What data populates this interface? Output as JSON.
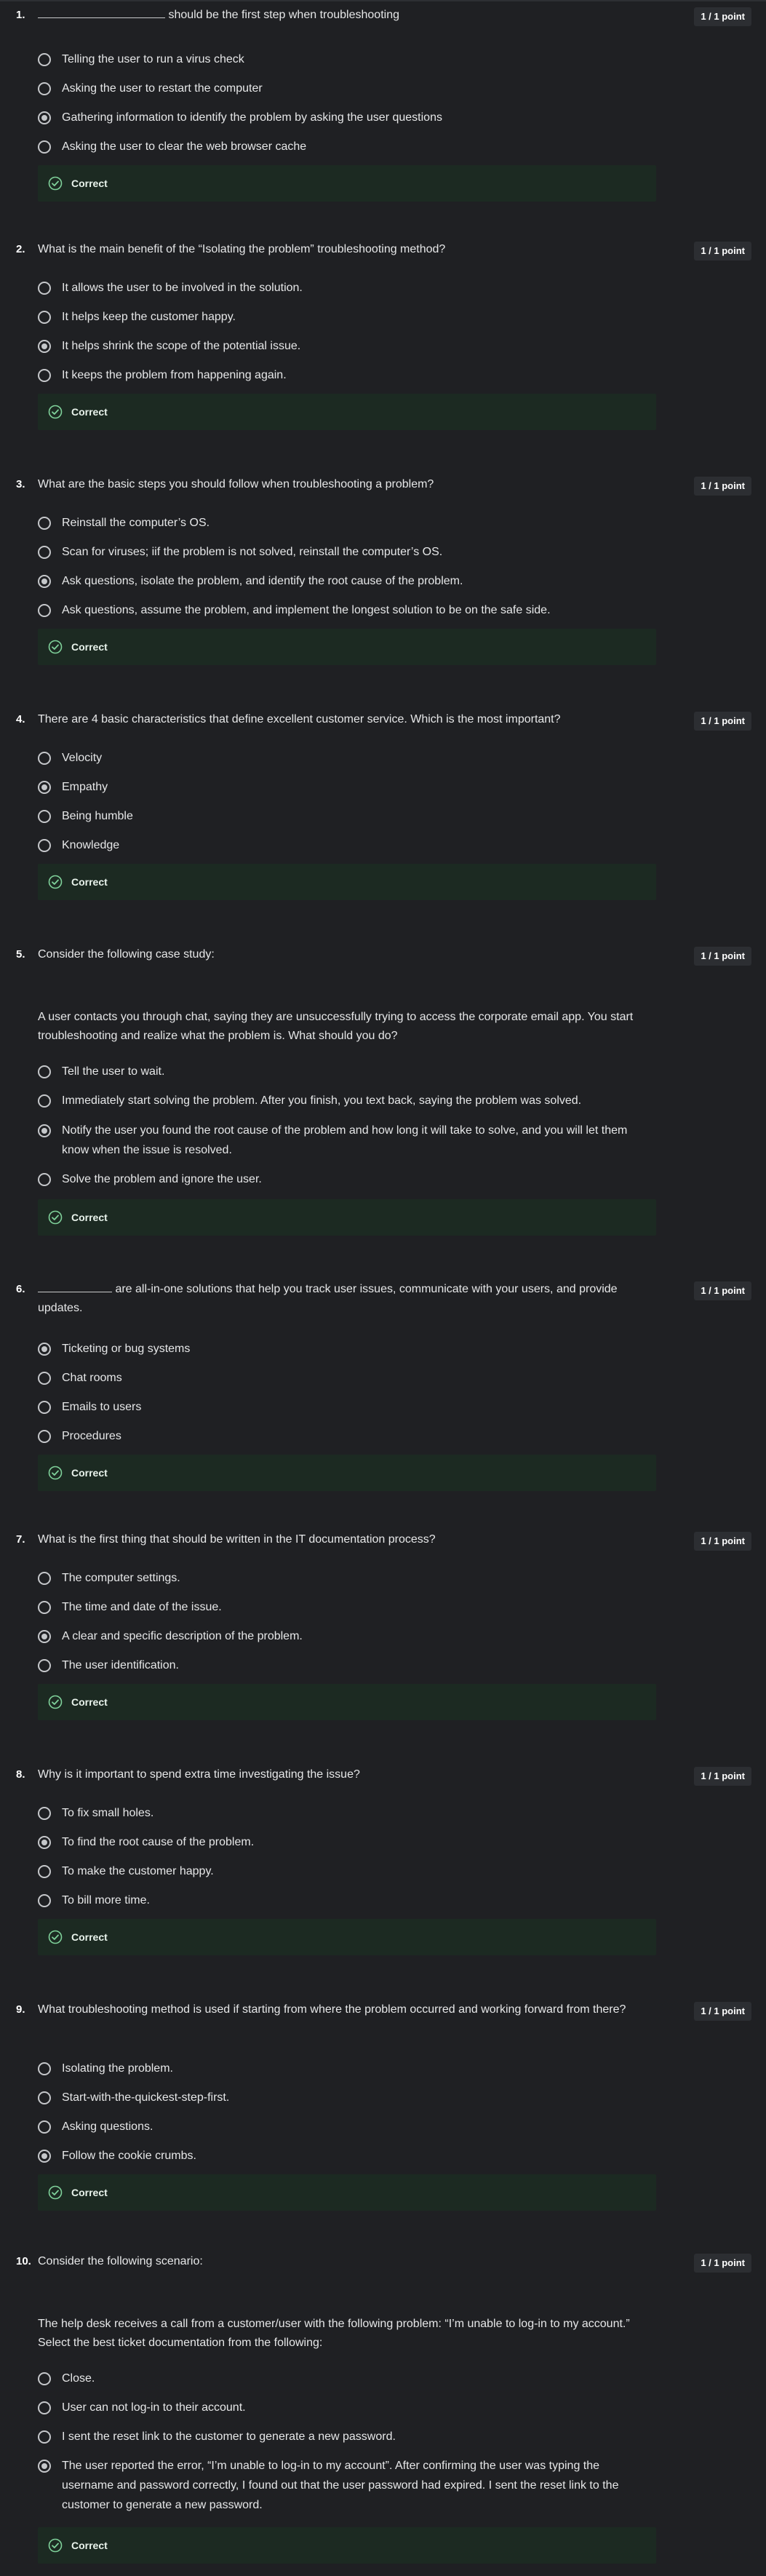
{
  "icons": {
    "radio": "radio-button-icon",
    "check": "check-circle-icon"
  },
  "colors": {
    "background": "#1f2023",
    "feedback_bg": "#1c2a22",
    "check": "#7fd19a",
    "points_bg": "#2c2e32"
  },
  "questions": [
    {
      "number": "1.",
      "prompt": " should be the first step when troubleshooting",
      "points": "1 / 1 point",
      "options": [
        "Telling the user to run a virus check",
        "Asking the user to restart the computer",
        "Gathering information to identify the problem by asking the user questions",
        "Asking the user to clear the web browser cache"
      ],
      "selected": 2,
      "feedback": "Correct"
    },
    {
      "number": "2.",
      "prompt": "What is the main benefit of the “Isolating the problem” troubleshooting method?",
      "points": "1 / 1 point",
      "options": [
        "It allows the user to be involved in the solution.",
        "It helps keep the customer happy.",
        "It helps shrink the scope of the potential issue.",
        "It keeps the problem from happening again."
      ],
      "selected": 2,
      "feedback": "Correct"
    },
    {
      "number": "3.",
      "prompt": "What are the basic steps you should follow when troubleshooting a problem?",
      "points": "1 / 1 point",
      "options": [
        "Reinstall the computer’s OS.",
        "Scan for viruses; iif the problem is not solved, reinstall the computer’s OS.",
        "Ask questions, isolate the problem, and identify the root cause of the problem.",
        "Ask questions, assume the problem, and implement the longest solution to be on the safe side."
      ],
      "selected": 2,
      "feedback": "Correct"
    },
    {
      "number": "4.",
      "prompt": "There are 4 basic characteristics that define excellent customer service. Which is the most important?",
      "points": "1 / 1 point",
      "options": [
        "Velocity",
        "Empathy",
        "Being humble",
        "Knowledge"
      ],
      "selected": 1,
      "feedback": "Correct"
    },
    {
      "number": "5.",
      "prompt": "Consider the following case study:",
      "body": "A user contacts you through chat, saying they are unsuccessfully trying to access the corporate email app. You start troubleshooting and realize what the problem is. What should you do?",
      "points": "1 / 1 point",
      "options": [
        "Tell the user to wait.",
        "Immediately start solving the problem. After you finish, you text back, saying the problem was solved.",
        "Notify the user you found the root cause of the problem and how long it will take to solve, and you will let them know when the issue is resolved.",
        "Solve the problem and ignore the user."
      ],
      "selected": 2,
      "feedback": "Correct"
    },
    {
      "number": "6.",
      "prompt": " are all-in-one solutions that help you track user issues, communicate with your users, and provide updates.",
      "points": "1 / 1 point",
      "options": [
        "Ticketing or bug systems",
        "Chat rooms",
        "Emails to users",
        "Procedures"
      ],
      "selected": 0,
      "feedback": "Correct"
    },
    {
      "number": "7.",
      "prompt": "What is the first thing that should be written in the IT documentation process?",
      "points": "1 / 1 point",
      "options": [
        "The computer settings.",
        "The time and date of the issue.",
        "A clear and specific description of the problem.",
        "The user identification."
      ],
      "selected": 2,
      "feedback": "Correct"
    },
    {
      "number": "8.",
      "prompt": "Why is it important to spend extra time investigating the issue?",
      "points": "1 / 1 point",
      "options": [
        "To fix small holes.",
        "To find the root cause of the problem.",
        "To make the customer happy.",
        "To bill more time."
      ],
      "selected": 1,
      "feedback": "Correct"
    },
    {
      "number": "9.",
      "prompt": "What troubleshooting method is used if starting from where the problem occurred and working forward from there?",
      "points": "1 / 1 point",
      "options": [
        "Isolating the problem.",
        "Start-with-the-quickest-step-first.",
        "Asking questions.",
        "Follow the cookie crumbs."
      ],
      "selected": 3,
      "feedback": "Correct"
    },
    {
      "number": "10.",
      "prompt": "Consider the following scenario:",
      "body": "The help desk receives a call from a customer/user with the following problem: “I’m unable to log-in to my account.” Select the best ticket documentation from the following:",
      "points": "1 / 1 point",
      "options": [
        "Close.",
        "User can not log-in to their account.",
        "I sent the reset link to the customer to generate a new password.",
        "The user reported the error, “I’m unable to log-in to my account”. After confirming the user was typing the username and password correctly, I found out that the user password had expired. I sent the reset link to the customer to generate a new password."
      ],
      "selected": 3,
      "feedback": "Correct"
    }
  ]
}
